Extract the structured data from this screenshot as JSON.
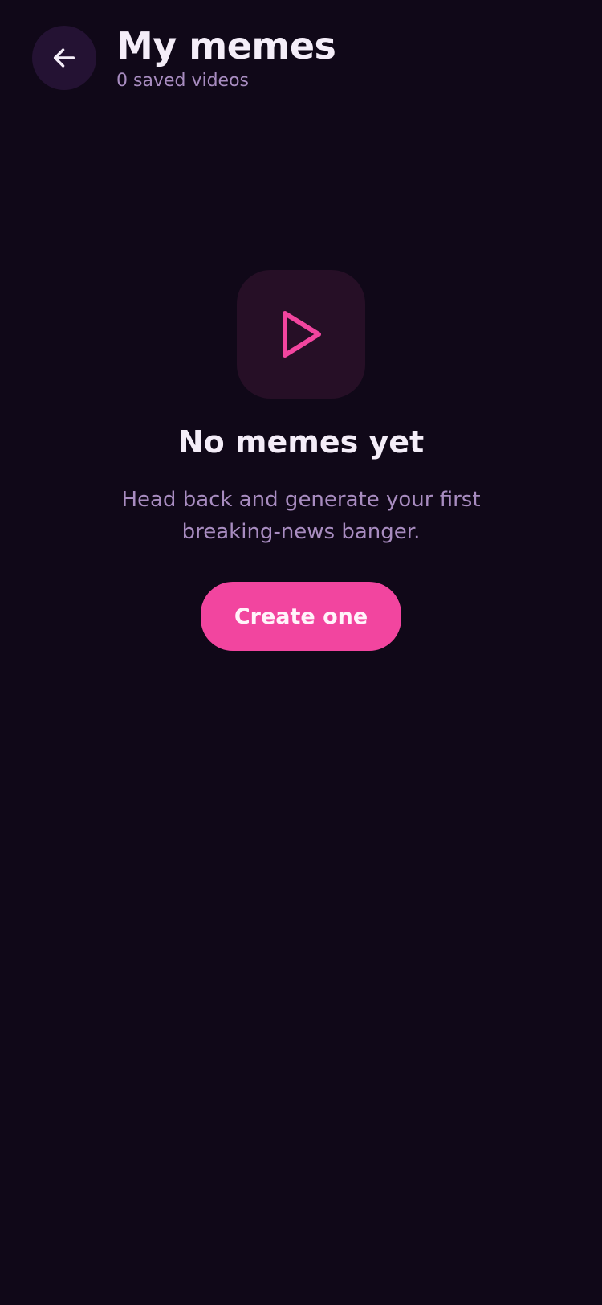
{
  "header": {
    "back_icon": "arrow-left-icon",
    "title": "My memes",
    "subtitle": "0 saved videos"
  },
  "empty_state": {
    "icon": "play-icon",
    "title": "No memes yet",
    "description": "Head back and generate your first breaking-news banger.",
    "cta_label": "Create one"
  },
  "colors": {
    "background": "#100818",
    "accent": "#f2459f",
    "muted_text": "#a88cc0",
    "primary_text": "#f4edf8",
    "back_button_bg": "#241233",
    "icon_tile_bg": "#260f26"
  }
}
